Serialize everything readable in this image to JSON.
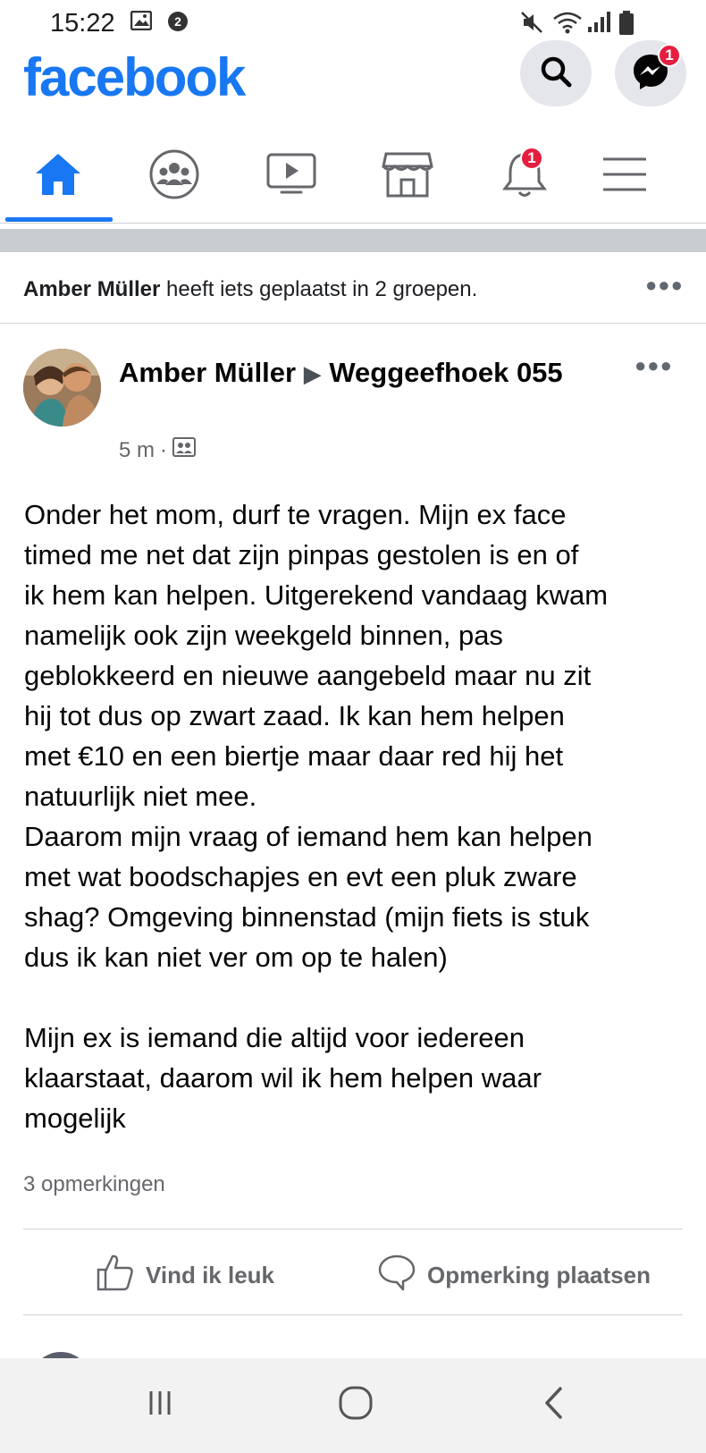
{
  "status_bar": {
    "time": "15:22"
  },
  "header": {
    "logo": "facebook",
    "messenger_badge": "1"
  },
  "tabs": {
    "items": [
      {
        "name": "home",
        "icon": "home-icon"
      },
      {
        "name": "groups",
        "icon": "groups-icon"
      },
      {
        "name": "watch",
        "icon": "video-icon"
      },
      {
        "name": "marketplace",
        "icon": "marketplace-icon"
      },
      {
        "name": "notifications",
        "icon": "bell-icon"
      },
      {
        "name": "menu",
        "icon": "hamburger-icon"
      }
    ],
    "notifications_badge": "1",
    "accent": "#1877f2"
  },
  "activity": {
    "actor": "Amber Müller",
    "text": " heeft iets geplaatst in 2 groepen."
  },
  "post": {
    "author": "Amber Müller",
    "separator": "▶",
    "group": "Weggeefhoek 055",
    "time": "5 m",
    "dot": "·",
    "body_lines": [
      "Onder het mom, durf te vragen. Mijn ex face",
      "timed me net dat zijn pinpas gestolen is en of",
      "ik hem kan helpen. Uitgerekend vandaag kwam",
      "namelijk ook zijn weekgeld binnen, pas",
      "geblokkeerd en nieuwe aangebeld maar nu zit",
      "hij tot dus op zwart zaad. Ik kan hem helpen",
      "met €10 en een biertje maar daar red hij het",
      "natuurlijk niet mee.",
      "Daarom mijn vraag of iemand hem kan helpen",
      "met wat boodschapjes en evt een pluk zware",
      "shag? Omgeving binnenstad (mijn fiets is stuk",
      "dus ik kan niet ver om op te halen)",
      "",
      "Mijn ex is iemand die altijd voor iedereen",
      "klaarstaat, daarom wil ik hem helpen waar",
      "mogelijk"
    ],
    "comments_count": "3 opmerkingen",
    "like_label": "Vind ik leuk",
    "comment_label": "Opmerking plaatsen"
  }
}
